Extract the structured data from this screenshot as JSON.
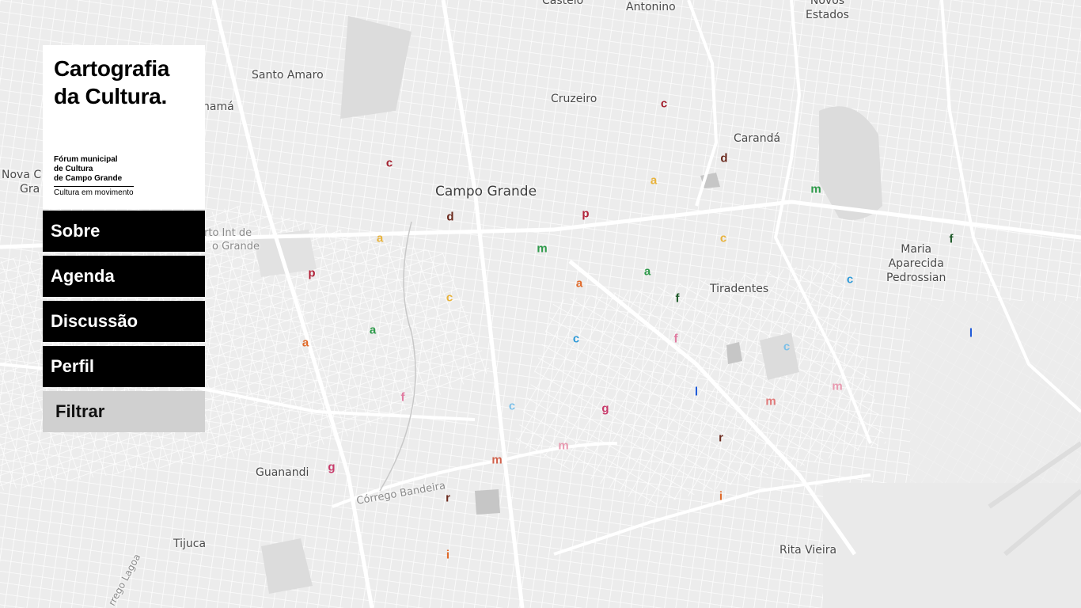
{
  "colors": {
    "map_background": "#ececec",
    "street": "#ffffff",
    "park": "#dcdcdc",
    "water": "#c6c6c6",
    "panel_button": "#000000",
    "panel_button_text": "#ffffff",
    "filter_button": "#d0d0d0"
  },
  "brand": {
    "title_line1": "Cartografia",
    "title_line2": "da Cultura.",
    "forum_line1": "Fórum municipal",
    "forum_line2": "de Cultura",
    "forum_line3": "de Campo Grande",
    "tagline": "Cultura em movimento"
  },
  "nav": {
    "sobre": "Sobre",
    "agenda": "Agenda",
    "discussao": "Discussão",
    "perfil": "Perfil",
    "filtrar": "Filtrar"
  },
  "places": {
    "castelo": "Castelo",
    "antonino": "Antonino",
    "novos_estados_1": "Novos",
    "novos_estados_2": "Estados",
    "santo_amaro": "Santo Amaro",
    "panama": "namá",
    "cruzeiro": "Cruzeiro",
    "caranda": "Carandá",
    "nova_1": "Nova C",
    "nova_2": "Gra",
    "campo_grande": "Campo Grande",
    "aeroporto_1": "rto Int de",
    "aeroporto_2": "o Grande",
    "maria_1": "Maria",
    "maria_2": "Aparecida",
    "maria_3": "Pedrossian",
    "tiradentes": "Tiradentes",
    "guanandi": "Guanandi",
    "corrego_bandeira": "Córrego Bandeira",
    "tijuca": "Tijuca",
    "rita_vieira": "Rita Vieira",
    "lagoa": "rrego Lagoa"
  },
  "markers": [
    {
      "letter": "c",
      "color": "#a31f2e"
    },
    {
      "letter": "d",
      "color": "#6b2a1e"
    },
    {
      "letter": "c",
      "color": "#a31f2e"
    },
    {
      "letter": "a",
      "color": "#e8b23a"
    },
    {
      "letter": "m",
      "color": "#2e9a4a"
    },
    {
      "letter": "d",
      "color": "#6b2a1e"
    },
    {
      "letter": "p",
      "color": "#b2243a"
    },
    {
      "letter": "a",
      "color": "#e8b23a"
    },
    {
      "letter": "m",
      "color": "#2e9a4a"
    },
    {
      "letter": "c",
      "color": "#e8b23a"
    },
    {
      "letter": "f",
      "color": "#1f5a2a"
    },
    {
      "letter": "p",
      "color": "#b2243a"
    },
    {
      "letter": "a",
      "color": "#e06a2a"
    },
    {
      "letter": "a",
      "color": "#2e9a4a"
    },
    {
      "letter": "c",
      "color": "#e8b23a"
    },
    {
      "letter": "f",
      "color": "#1f5a2a"
    },
    {
      "letter": "c",
      "color": "#2e9ad8"
    },
    {
      "letter": "a",
      "color": "#e06a2a"
    },
    {
      "letter": "a",
      "color": "#2e9a4a"
    },
    {
      "letter": "c",
      "color": "#2e9ad8"
    },
    {
      "letter": "f",
      "color": "#e07aa0"
    },
    {
      "letter": "c",
      "color": "#7cc0e8"
    },
    {
      "letter": "l",
      "color": "#1f5ad8"
    },
    {
      "letter": "f",
      "color": "#e07aa0"
    },
    {
      "letter": "l",
      "color": "#1f5ad8"
    },
    {
      "letter": "c",
      "color": "#7cc0e8"
    },
    {
      "letter": "g",
      "color": "#c83a6a"
    },
    {
      "letter": "m",
      "color": "#e07a7a"
    },
    {
      "letter": "m",
      "color": "#e89ab0"
    },
    {
      "letter": "m",
      "color": "#e89ab0"
    },
    {
      "letter": "r",
      "color": "#6b2a1e"
    },
    {
      "letter": "m",
      "color": "#d0604a"
    },
    {
      "letter": "g",
      "color": "#c83a6a"
    },
    {
      "letter": "r",
      "color": "#6b2a1e"
    },
    {
      "letter": "i",
      "color": "#e06a2a"
    },
    {
      "letter": "i",
      "color": "#e06a2a"
    }
  ]
}
